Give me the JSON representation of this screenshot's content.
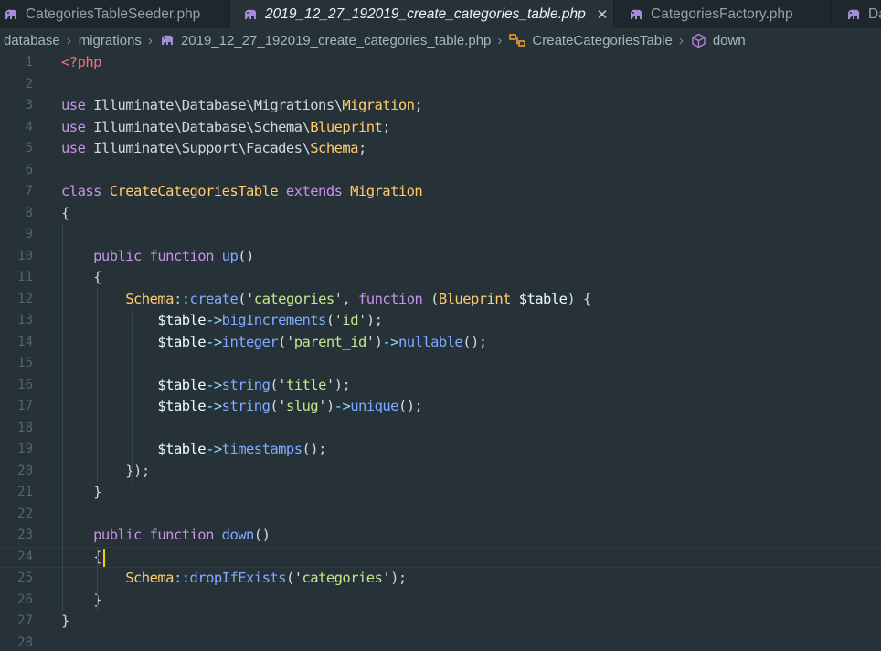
{
  "tabs": [
    {
      "label": "CategoriesTableSeeder.php",
      "active": false
    },
    {
      "label": "2019_12_27_192019_create_categories_table.php",
      "active": true
    },
    {
      "label": "CategoriesFactory.php",
      "active": false
    },
    {
      "label": "Da",
      "active": false
    }
  ],
  "breadcrumb": [
    "database",
    "migrations",
    "2019_12_27_192019_create_categories_table.php",
    "CreateCategoriesTable",
    "down"
  ],
  "editor": {
    "line_numbers": [
      "1",
      "2",
      "3",
      "4",
      "5",
      "6",
      "7",
      "8",
      "9",
      "10",
      "11",
      "12",
      "13",
      "14",
      "15",
      "16",
      "17",
      "18",
      "19",
      "20",
      "21",
      "22",
      "23",
      "24",
      "25",
      "26",
      "27",
      "28"
    ],
    "lines": [
      [
        [
          "tag",
          "<?php"
        ]
      ],
      [],
      [
        [
          "kw",
          "use "
        ],
        [
          "plain",
          "Illuminate\\Database\\Migrations\\"
        ],
        [
          "cls",
          "Migration"
        ],
        [
          "plain",
          ";"
        ]
      ],
      [
        [
          "kw",
          "use "
        ],
        [
          "plain",
          "Illuminate\\Database\\Schema\\"
        ],
        [
          "cls",
          "Blueprint"
        ],
        [
          "plain",
          ";"
        ]
      ],
      [
        [
          "kw",
          "use "
        ],
        [
          "plain",
          "Illuminate\\Support\\Facades\\"
        ],
        [
          "cls",
          "Schema"
        ],
        [
          "plain",
          ";"
        ]
      ],
      [],
      [
        [
          "kw",
          "class "
        ],
        [
          "cls",
          "CreateCategoriesTable "
        ],
        [
          "kw",
          "extends "
        ],
        [
          "cls",
          "Migration"
        ]
      ],
      [
        [
          "plain",
          "{"
        ]
      ],
      [],
      [
        [
          "plain",
          "    "
        ],
        [
          "kw",
          "public function "
        ],
        [
          "fn",
          "up"
        ],
        [
          "plain",
          "()"
        ]
      ],
      [
        [
          "plain",
          "    {"
        ]
      ],
      [
        [
          "plain",
          "        "
        ],
        [
          "cls",
          "Schema"
        ],
        [
          "op",
          "::"
        ],
        [
          "fn",
          "create"
        ],
        [
          "plain",
          "('"
        ],
        [
          "str",
          "categories"
        ],
        [
          "plain",
          "', "
        ],
        [
          "kw",
          "function "
        ],
        [
          "plain",
          "("
        ],
        [
          "cls",
          "Blueprint "
        ],
        [
          "var",
          "$table"
        ],
        [
          "plain",
          ") {"
        ]
      ],
      [
        [
          "plain",
          "            "
        ],
        [
          "var",
          "$table"
        ],
        [
          "op",
          "->"
        ],
        [
          "fn",
          "bigIncrements"
        ],
        [
          "plain",
          "('"
        ],
        [
          "str",
          "id"
        ],
        [
          "plain",
          "');"
        ]
      ],
      [
        [
          "plain",
          "            "
        ],
        [
          "var",
          "$table"
        ],
        [
          "op",
          "->"
        ],
        [
          "fn",
          "integer"
        ],
        [
          "plain",
          "('"
        ],
        [
          "str",
          "parent_id"
        ],
        [
          "plain",
          "')"
        ],
        [
          "op",
          "->"
        ],
        [
          "fn",
          "nullable"
        ],
        [
          "plain",
          "();"
        ]
      ],
      [],
      [
        [
          "plain",
          "            "
        ],
        [
          "var",
          "$table"
        ],
        [
          "op",
          "->"
        ],
        [
          "fn",
          "string"
        ],
        [
          "plain",
          "('"
        ],
        [
          "str",
          "title"
        ],
        [
          "plain",
          "');"
        ]
      ],
      [
        [
          "plain",
          "            "
        ],
        [
          "var",
          "$table"
        ],
        [
          "op",
          "->"
        ],
        [
          "fn",
          "string"
        ],
        [
          "plain",
          "('"
        ],
        [
          "str",
          "slug"
        ],
        [
          "plain",
          "')"
        ],
        [
          "op",
          "->"
        ],
        [
          "fn",
          "unique"
        ],
        [
          "plain",
          "();"
        ]
      ],
      [],
      [
        [
          "plain",
          "            "
        ],
        [
          "var",
          "$table"
        ],
        [
          "op",
          "->"
        ],
        [
          "fn",
          "timestamps"
        ],
        [
          "plain",
          "();"
        ]
      ],
      [
        [
          "plain",
          "        });"
        ]
      ],
      [
        [
          "plain",
          "    }"
        ]
      ],
      [],
      [
        [
          "plain",
          "    "
        ],
        [
          "kw",
          "public function "
        ],
        [
          "fn",
          "down"
        ],
        [
          "plain",
          "()"
        ]
      ],
      [
        [
          "plain",
          "    {"
        ]
      ],
      [
        [
          "plain",
          "        "
        ],
        [
          "cls",
          "Schema"
        ],
        [
          "op",
          "::"
        ],
        [
          "fn",
          "dropIfExists"
        ],
        [
          "plain",
          "('"
        ],
        [
          "str",
          "categories"
        ],
        [
          "plain",
          "');"
        ]
      ],
      [
        [
          "plain",
          "    }"
        ]
      ],
      [
        [
          "plain",
          "}"
        ]
      ],
      []
    ]
  },
  "theme": {
    "background": "#263238",
    "keyword": "#c792ea",
    "class": "#ffcb6b",
    "function": "#82aaff",
    "string": "#c3e88d",
    "tag": "#f07178",
    "cursor": "#ffcc00"
  },
  "icons": [
    "php-elephant-icon",
    "close-icon",
    "chevron-right-icon",
    "class-symbol-icon",
    "method-cube-icon"
  ]
}
